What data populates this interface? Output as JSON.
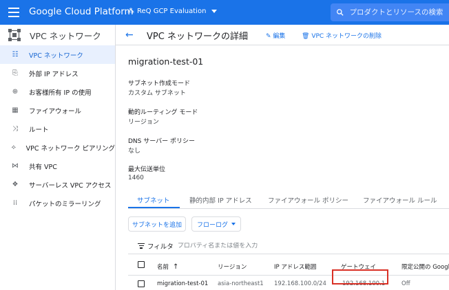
{
  "topbar": {
    "brand": "Google Cloud Platform",
    "project": "ReQ GCP Evaluation",
    "search_placeholder": "プロダクトとリソースの検索"
  },
  "sidebar": {
    "title": "VPC ネットワーク",
    "items": [
      {
        "label": "VPC ネットワーク",
        "icon": "vpc-network-icon",
        "active": true
      },
      {
        "label": "外部 IP アドレス",
        "icon": "external-ip-icon",
        "active": false
      },
      {
        "label": "お客様所有 IP の使用",
        "icon": "byoip-icon",
        "active": false
      },
      {
        "label": "ファイアウォール",
        "icon": "firewall-icon",
        "active": false
      },
      {
        "label": "ルート",
        "icon": "route-icon",
        "active": false
      },
      {
        "label": "VPC ネットワーク ピアリング",
        "icon": "peering-icon",
        "active": false
      },
      {
        "label": "共有 VPC",
        "icon": "shared-vpc-icon",
        "active": false
      },
      {
        "label": "サーバーレス VPC アクセス",
        "icon": "serverless-icon",
        "active": false
      },
      {
        "label": "パケットのミラーリング",
        "icon": "packet-mirroring-icon",
        "active": false
      }
    ]
  },
  "header": {
    "title": "VPC ネットワークの詳細",
    "edit_label": "編集",
    "delete_label": "VPC ネットワークの削除"
  },
  "details": {
    "name": "migration-test-01",
    "subnet_mode_label": "サブネット作成モード",
    "subnet_mode_value": "カスタム サブネット",
    "routing_mode_label": "動的ルーティング モード",
    "routing_mode_value": "リージョン",
    "dns_policy_label": "DNS サーバー ポリシー",
    "dns_policy_value": "なし",
    "mtu_label": "最大伝送単位",
    "mtu_value": "1460"
  },
  "tabs": [
    {
      "label": "サブネット",
      "active": true
    },
    {
      "label": "静的内部 IP アドレス",
      "active": false
    },
    {
      "label": "ファイアウォール ポリシー",
      "active": false
    },
    {
      "label": "ファイアウォール ルール",
      "active": false
    }
  ],
  "buttons": {
    "add_subnet": "サブネットを追加",
    "flow_logs": "フローログ"
  },
  "filter": {
    "label": "フィルタ",
    "placeholder": "プロパティ名または値を入力"
  },
  "table": {
    "columns": [
      "名前",
      "リージョン",
      "IP アドレス範囲",
      "ゲートウェイ",
      "限定公開の Google"
    ],
    "rows": [
      [
        "migration-test-01",
        "asia-northeast1",
        "192.168.100.0/24",
        "192.168.100.1",
        "Off"
      ]
    ]
  },
  "colors": {
    "primary": "#1a73e8",
    "highlight": "#d93025"
  }
}
